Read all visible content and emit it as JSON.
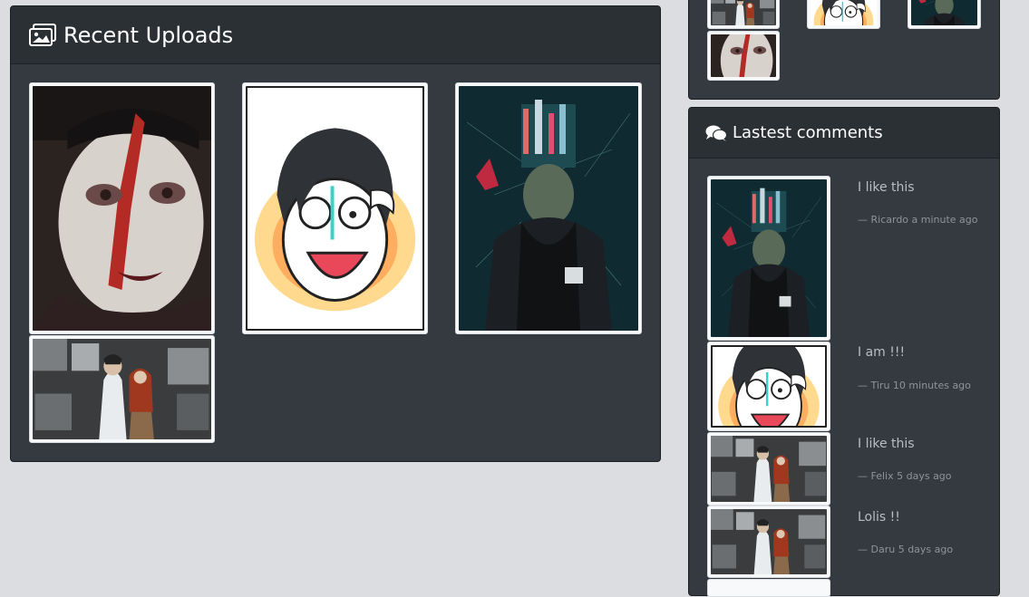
{
  "uploads": {
    "title": "Recent Uploads",
    "icon": "images-icon",
    "items": [
      {
        "name": "clown-face-thumbnail"
      },
      {
        "name": "cartoon-girl-thumbnail"
      },
      {
        "name": "hooded-man-thumbnail"
      },
      {
        "name": "anime-couple-thumbnail"
      }
    ]
  },
  "comments_panel": {
    "title": "Lastest comments",
    "icon": "comments-icon",
    "items": [
      {
        "text": "I like this",
        "meta": "— Ricardo a minute ago",
        "thumb": "hooded-man"
      },
      {
        "text": "I am !!!",
        "meta": "— Tiru 10 minutes ago",
        "thumb": "cartoon-girl"
      },
      {
        "text": "I like this",
        "meta": "— Felix 5 days ago",
        "thumb": "anime-couple"
      },
      {
        "text": "Lolis !!",
        "meta": "— Daru 5 days ago",
        "thumb": "anime-couple"
      }
    ]
  },
  "colors": {
    "page_bg": "#dcdde1",
    "panel_bg": "#343a40",
    "header_bg": "#2b3035",
    "comment_text": "#b8bec4"
  }
}
